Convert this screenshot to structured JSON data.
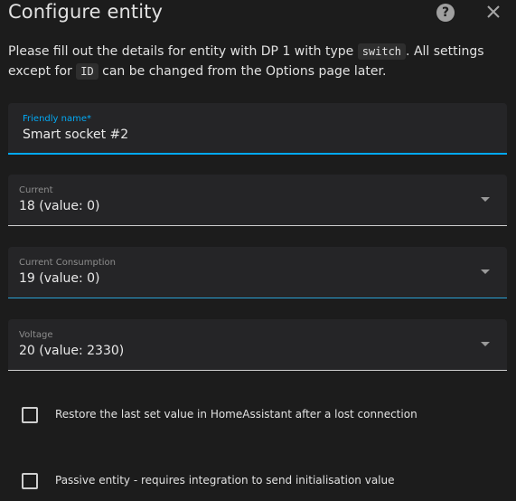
{
  "dialog": {
    "title": "Configure entity",
    "description": {
      "part1": "Please fill out the details for entity with DP 1 with type ",
      "code1": "switch",
      "part2": ". All settings except for ",
      "code2": "ID",
      "part3": " can be changed from the Options page later."
    }
  },
  "fields": {
    "friendly_name": {
      "label": "Friendly name*",
      "value": "Smart socket #2"
    },
    "current": {
      "label": "Current",
      "value": "18 (value: 0)"
    },
    "current_consumption": {
      "label": "Current Consumption",
      "value": "19 (value: 0)"
    },
    "voltage": {
      "label": "Voltage",
      "value": "20 (value: 2330)"
    }
  },
  "checkboxes": {
    "restore": {
      "label": "Restore the last set value in HomeAssistant after a lost connection",
      "checked": false
    },
    "passive": {
      "label": "Passive entity - requires integration to send initialisation value",
      "checked": false
    }
  },
  "icons": {
    "help": "help-circle-icon",
    "close": "close-icon"
  },
  "colors": {
    "accent": "#03a9f4",
    "background": "#1c1c1c",
    "field_background": "#252527"
  }
}
